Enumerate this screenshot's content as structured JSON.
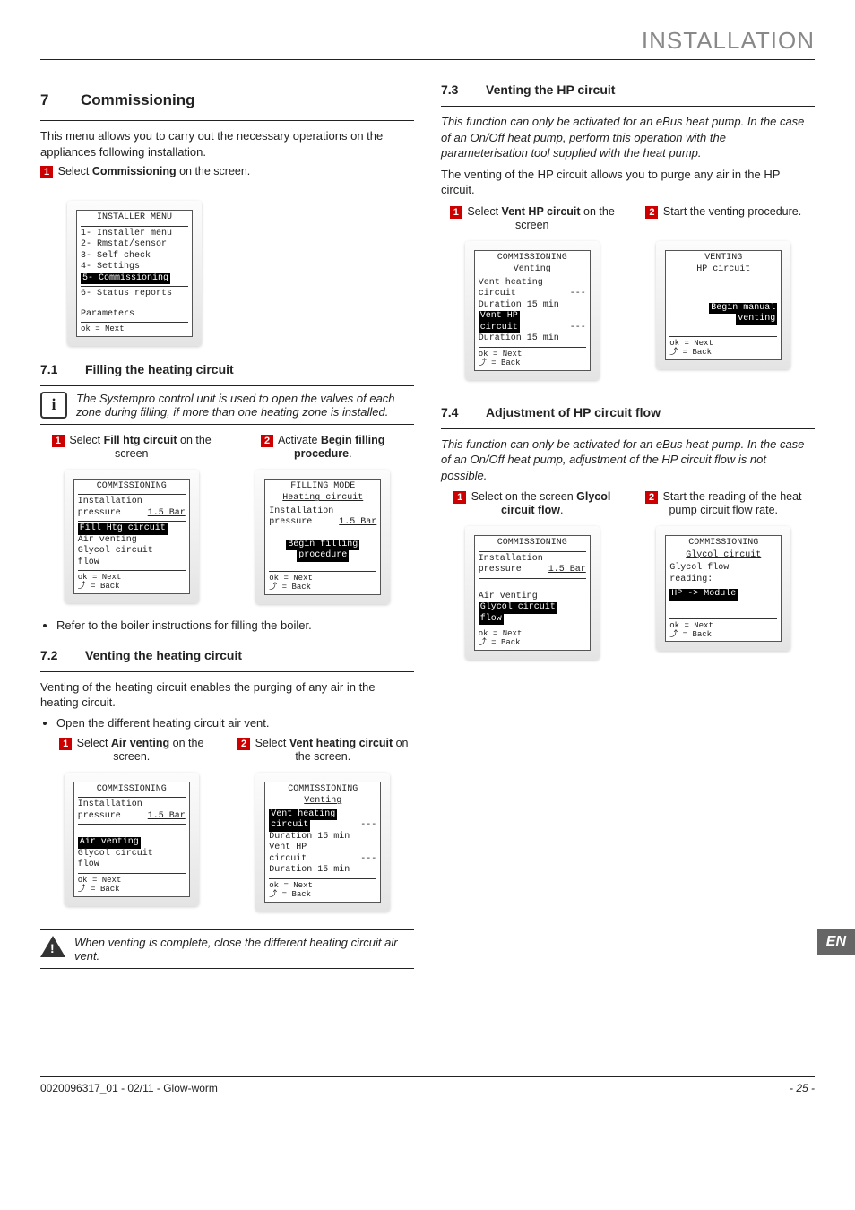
{
  "page_header": "INSTALLATION",
  "sec7": {
    "num": "7",
    "title": "Commissioning"
  },
  "intro7": "This menu allows you to carry out the necessary operations on the appliances following installation.",
  "step7_0_pre": "Select ",
  "step7_0_bold": "Commissioning",
  "step7_0_post": " on the screen.",
  "lcd_installer": {
    "title": "INSTALLER MENU",
    "l1": "1- Installer menu",
    "l2": "2- Rmstat/sensor",
    "l3": "3- Self check",
    "l4": "4- Settings",
    "l5": "5- Commissioning",
    "l6": "6- Status reports",
    "l7": "Parameters",
    "foot": "ok  = Next"
  },
  "sec71": {
    "num": "7.1",
    "title": "Filling the heating circuit"
  },
  "note71": "The Systempro control unit is used to open the valves of each zone during filling, if more than one heating zone is installed.",
  "step71_1_pre": "Select ",
  "step71_1_bold": "Fill htg circuit",
  "step71_1_post": " on the screen",
  "step71_2_pre": "Activate ",
  "step71_2_bold": "Begin filling procedure",
  "step71_2_post": ".",
  "lcd_71a": {
    "title": "COMMISSIONING",
    "l1": "Installation",
    "l2": "pressure",
    "v2": "1.5 Bar",
    "sel": "Fill Htg circuit",
    "l4": "Air venting",
    "l5": "Glycol circuit",
    "l6": "flow",
    "foot1": "ok  = Next",
    "foot2": "⤴   = Back"
  },
  "lcd_71b": {
    "title": "FILLING MODE",
    "title2": "Heating circuit",
    "l1": "Installation",
    "l2": "pressure",
    "v2": "1.5 Bar",
    "sel1": "Begin filling",
    "sel2": "procedure",
    "foot1": "ok  = Next",
    "foot2": "⤴   = Back"
  },
  "bullet71": "Refer to the boiler instructions for filling the boiler.",
  "sec72": {
    "num": "7.2",
    "title": "Venting the heating circuit"
  },
  "para72": "Venting of the heating circuit enables the purging of any air in the heating circuit.",
  "bullet72": "Open the different heating circuit air vent.",
  "step72_1_pre": "Select ",
  "step72_1_bold": "Air venting",
  "step72_1_post": " on the screen.",
  "step72_2_pre": "Select ",
  "step72_2_bold": "Vent heating circuit",
  "step72_2_post": " on the screen.",
  "lcd_72a": {
    "title": "COMMISSIONING",
    "l1": "Installation",
    "l2": "pressure",
    "v2": "1.5 Bar",
    "sel": "Air venting",
    "l4": "Glycol circuit",
    "l5": "flow",
    "foot1": "ok  = Next",
    "foot2": "⤴   = Back"
  },
  "lcd_72b": {
    "title": "COMMISSIONING",
    "title2": "Venting",
    "sel1": "Vent heating",
    "sel2": "circuit",
    "v1": "---",
    "l3": "Duration 15 min",
    "l4": "Vent HP",
    "l5": "circuit",
    "v5": "---",
    "l6": "Duration 15 min",
    "foot1": "ok  = Next",
    "foot2": "⤴   = Back"
  },
  "warn72": "When venting is complete, close the different heating circuit air vent.",
  "sec73": {
    "num": "7.3",
    "title": "Venting the HP circuit"
  },
  "para73a": "This function can only be activated for an eBus heat pump. In the case of an On/Off heat pump, perform this operation with the parameterisation tool supplied with the heat pump.",
  "para73b": "The venting of the HP circuit allows you to purge any air in the HP circuit.",
  "step73_1_pre": "Select ",
  "step73_1_bold": "Vent HP circuit",
  "step73_1_post": " on the screen",
  "step73_2": "Start the venting procedure.",
  "lcd_73a": {
    "title": "COMMISSIONING",
    "title2": "Venting",
    "l1": "Vent heating",
    "l2": "circuit",
    "v2": "---",
    "l3": "Duration 15 min",
    "sel1": "Vent HP",
    "sel2": "circuit",
    "v5": "---",
    "l6": "Duration 15 min",
    "foot1": "ok  = Next",
    "foot2": "⤴   = Back"
  },
  "lcd_73b": {
    "title": "VENTING",
    "title2": "HP circuit",
    "sel1": "Begin manual",
    "sel2": "venting",
    "foot1": "ok  = Next",
    "foot2": "⤴   = Back"
  },
  "sec74": {
    "num": "7.4",
    "title": "Adjustment of HP circuit flow"
  },
  "para74": "This function can only be activated for an eBus heat pump. In the case of an On/Off heat pump, adjustment of the HP circuit flow is not possible.",
  "step74_1_pre": "Select on the screen ",
  "step74_1_bold": "Glycol circuit flow",
  "step74_1_post": ".",
  "step74_2": "Start the reading of the heat pump circuit flow rate.",
  "lcd_74a": {
    "title": "COMMISSIONING",
    "l1": "Installation",
    "l2": "pressure",
    "v2": "1.5 Bar",
    "l3": "Air venting",
    "sel1": "Glycol circuit",
    "sel2": "flow",
    "foot1": "ok  = Next",
    "foot2": "⤴   = Back"
  },
  "lcd_74b": {
    "title": "COMMISSIONING",
    "title2": "Glycol circuit",
    "l1": "Glycol flow",
    "l2": "reading:",
    "sel": "HP -> Module",
    "foot1": "ok  = Next",
    "foot2": "⤴   = Back"
  },
  "lang": "EN",
  "doc_ref": "0020096317_01 - 02/11 - Glow-worm",
  "page_num": "- 25 -",
  "box": {
    "n1": "1",
    "n2": "2"
  }
}
